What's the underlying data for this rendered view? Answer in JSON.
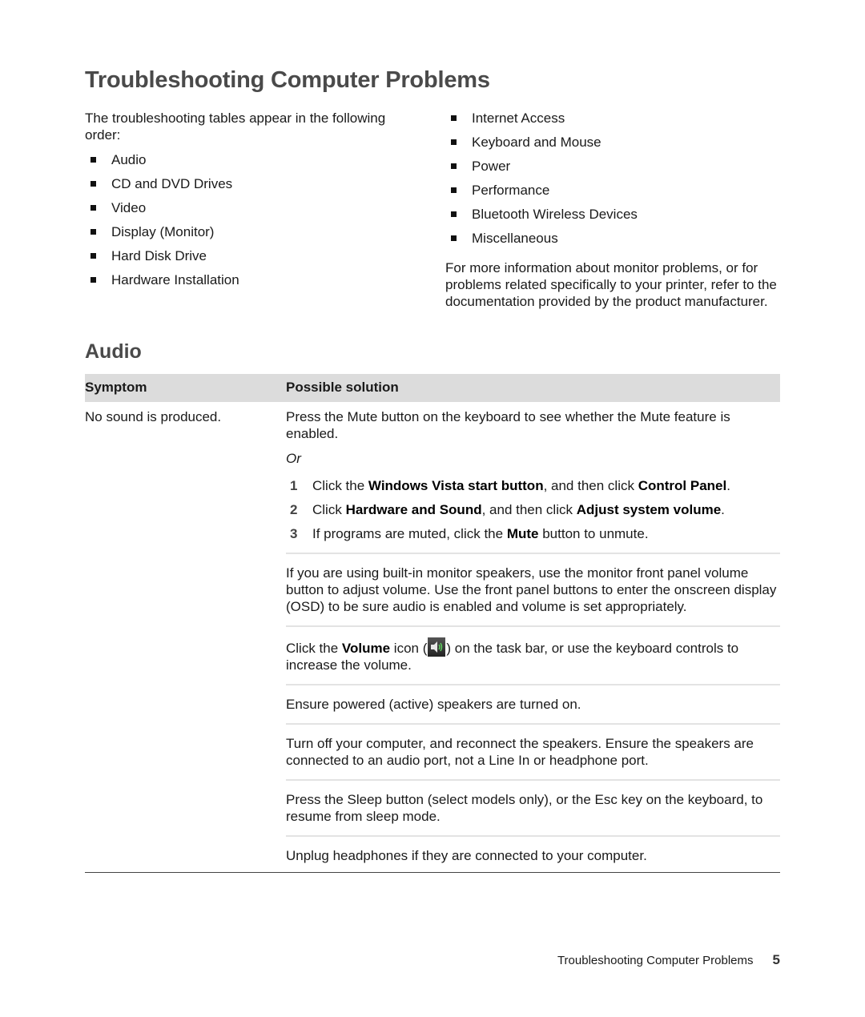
{
  "page": {
    "title": "Troubleshooting Computer Problems",
    "intro": "The troubleshooting tables appear in the following order:",
    "list_left": [
      "Audio",
      "CD and DVD Drives",
      "Video",
      "Display (Monitor)",
      "Hard Disk Drive",
      "Hardware Installation"
    ],
    "list_right": [
      "Internet Access",
      "Keyboard and Mouse",
      "Power",
      "Performance",
      "Bluetooth Wireless Devices",
      "Miscellaneous"
    ],
    "note": "For more information about monitor problems, or for problems related specifically to your printer, refer to the documentation provided by the product manufacturer."
  },
  "audio": {
    "title": "Audio",
    "headers": {
      "symptom": "Symptom",
      "solution": "Possible solution"
    },
    "symptom": "No sound is produced.",
    "sol1": {
      "text": "Press the Mute button on the keyboard to see whether the Mute feature is enabled.",
      "or": "Or",
      "steps": [
        {
          "num": "1",
          "a": "Click the ",
          "b1": "Windows Vista start button",
          "c": ", and then click ",
          "b2": "Control Panel",
          "d": "."
        },
        {
          "num": "2",
          "a": "Click ",
          "b1": "Hardware and Sound",
          "c": ", and then click ",
          "b2": "Adjust system volume",
          "d": "."
        },
        {
          "num": "3",
          "a": "If programs are muted, click the ",
          "b1": "Mute",
          "c": " button to unmute.",
          "b2": "",
          "d": ""
        }
      ]
    },
    "sol2": "If you are using built-in monitor speakers, use the monitor front panel volume button to adjust volume. Use the front panel buttons to enter the onscreen display (OSD) to be sure audio is enabled and volume is set appropriately.",
    "sol3": {
      "a": "Click the ",
      "b": "Volume",
      "c": " icon (",
      "icon": "speaker-volume-icon",
      "d": ") on the task bar, or use the keyboard controls to increase the volume."
    },
    "sol4": "Ensure powered (active) speakers are turned on.",
    "sol5": "Turn off your computer, and reconnect the speakers. Ensure the speakers are connected to an audio port, not a Line In or headphone port.",
    "sol6": "Press the Sleep button (select models only), or the Esc key on the keyboard, to resume from sleep mode.",
    "sol7": "Unplug headphones if they are connected to your computer."
  },
  "footer": {
    "text": "Troubleshooting Computer Problems",
    "page_number": "5"
  }
}
